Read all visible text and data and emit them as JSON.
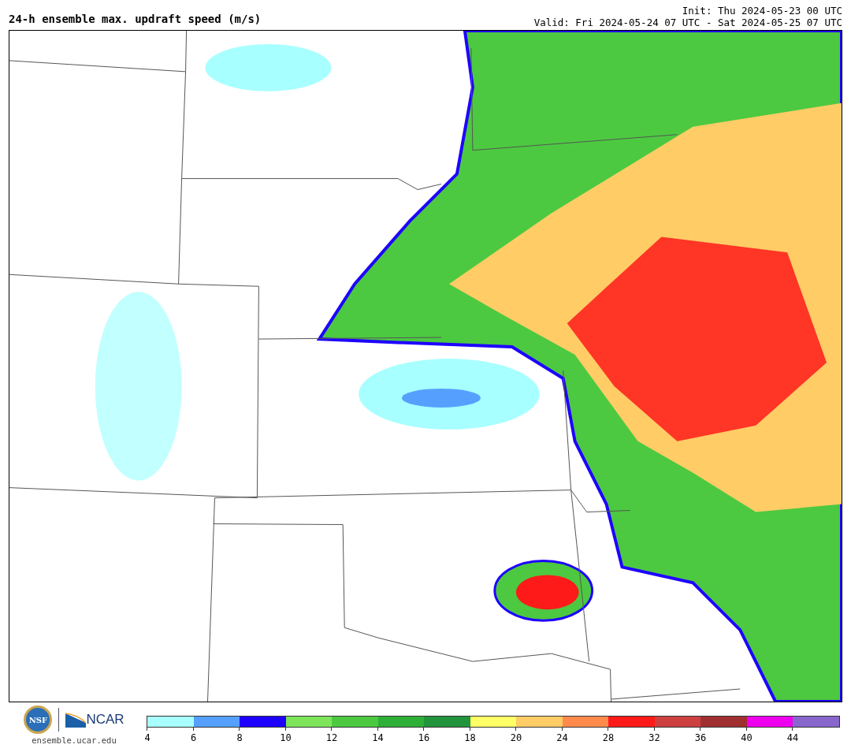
{
  "header": {
    "title": "24-h ensemble max. updraft speed (m/s)",
    "init": "Init: Thu 2024-05-23 00 UTC",
    "valid": "Valid: Fri 2024-05-24 07 UTC - Sat 2024-05-25 07 UTC"
  },
  "logos": {
    "nsf": "NSF",
    "ncar": "NCAR",
    "url": "ensemble.ucar.edu"
  },
  "colorbar": {
    "bins": [
      {
        "color": "#a8ffff",
        "label": "4"
      },
      {
        "color": "#55a0ff",
        "label": "6"
      },
      {
        "color": "#1e00ff",
        "label": "8"
      },
      {
        "color": "#7ee55a",
        "label": "10"
      },
      {
        "color": "#4cc940",
        "label": "12"
      },
      {
        "color": "#2eaf38",
        "label": "14"
      },
      {
        "color": "#22943c",
        "label": "16"
      },
      {
        "color": "#ffff66",
        "label": "18"
      },
      {
        "color": "#ffcc66",
        "label": "20"
      },
      {
        "color": "#ff8a4c",
        "label": "24"
      },
      {
        "color": "#ff1a1a",
        "label": "28"
      },
      {
        "color": "#cc4040",
        "label": "32"
      },
      {
        "color": "#a03030",
        "label": "36"
      },
      {
        "color": "#ee00ee",
        "label": "40"
      },
      {
        "color": "#8866cc",
        "label": "44"
      }
    ]
  }
}
